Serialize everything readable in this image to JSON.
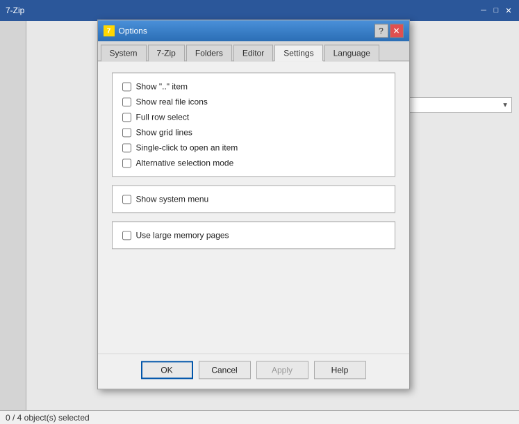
{
  "background": {
    "titlebar_title": "7-Zip",
    "statusbar_text": "0 / 4 object(s) selected"
  },
  "dialog": {
    "title": "Options",
    "titlebar_help": "?",
    "titlebar_close": "✕",
    "tabs": [
      {
        "label": "System",
        "active": false
      },
      {
        "label": "7-Zip",
        "active": false
      },
      {
        "label": "Folders",
        "active": false
      },
      {
        "label": "Editor",
        "active": false
      },
      {
        "label": "Settings",
        "active": true
      },
      {
        "label": "Language",
        "active": false
      }
    ],
    "checkboxes": [
      {
        "id": "show_dotdot",
        "label": "Show \"..\" item",
        "checked": false
      },
      {
        "id": "show_real_icons",
        "label": "Show real file icons",
        "checked": false
      },
      {
        "id": "full_row_select",
        "label": "Full row select",
        "checked": false
      },
      {
        "id": "show_grid_lines",
        "label": "Show grid lines",
        "checked": false
      },
      {
        "id": "single_click",
        "label": "Single-click to open an item",
        "checked": false
      },
      {
        "id": "alt_selection",
        "label": "Alternative selection mode",
        "checked": false
      }
    ],
    "checkboxes2": [
      {
        "id": "show_sys_menu",
        "label": "Show system menu",
        "checked": false
      }
    ],
    "checkboxes3": [
      {
        "id": "large_memory",
        "label": "Use large memory pages",
        "checked": false
      }
    ],
    "buttons": {
      "ok": "OK",
      "cancel": "Cancel",
      "apply": "Apply",
      "help": "Help"
    }
  }
}
